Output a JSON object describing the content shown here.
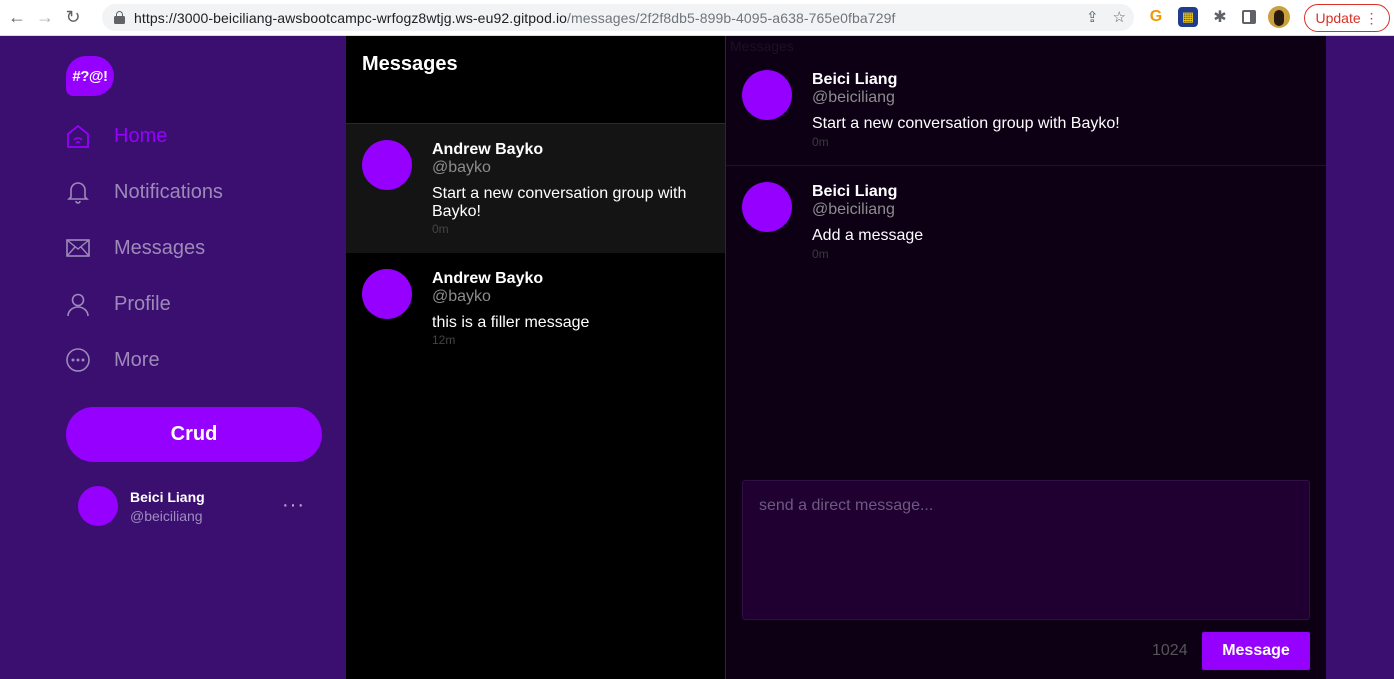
{
  "browser": {
    "back": "←",
    "forward": "→",
    "reload": "↻",
    "url_host": "https://3000-beiciliang-awsbootcampc-wrfogz8wtjg.ws-eu92.gitpod.io",
    "url_path": "/messages/2f2f8db5-899b-4095-a638-765e0fba729f",
    "share": "⇪",
    "star": "☆",
    "ext_g": "G",
    "ext_b": "▦",
    "ext_puzzle": "✱",
    "update_label": "Update",
    "update_dots": "⋮"
  },
  "logo": {
    "text": "#?@!"
  },
  "nav": [
    {
      "label": "Home",
      "icon": "home-icon",
      "active": true
    },
    {
      "label": "Notifications",
      "icon": "bell-icon"
    },
    {
      "label": "Messages",
      "icon": "envelope-icon"
    },
    {
      "label": "Profile",
      "icon": "user-icon"
    },
    {
      "label": "More",
      "icon": "more-circle-icon"
    }
  ],
  "crud_button": "Crud",
  "current_user": {
    "name": "Beici Liang",
    "handle": "@beiciliang",
    "menu": "···"
  },
  "groups": {
    "title": "Messages",
    "items": [
      {
        "name": "Andrew Bayko",
        "handle": "@bayko",
        "message": "Start a new conversation group with Bayko!",
        "time": "0m"
      },
      {
        "name": "Andrew Bayko",
        "handle": "@bayko",
        "message": "this is a filler message",
        "time": "12m"
      }
    ]
  },
  "conversation": {
    "ghost_title": "Messages",
    "messages": [
      {
        "name": "Beici Liang",
        "handle": "@beiciliang",
        "text": "Start a new conversation group with Bayko!",
        "time": "0m"
      },
      {
        "name": "Beici Liang",
        "handle": "@beiciliang",
        "text": "Add a message",
        "time": "0m"
      }
    ],
    "compose_placeholder": "send a direct message...",
    "char_count": "1024",
    "send_label": "Message"
  },
  "colors": {
    "brand_purple": "#9500ff",
    "sidebar_bg": "#3a0f70",
    "conversation_bg": "#0d0015"
  }
}
